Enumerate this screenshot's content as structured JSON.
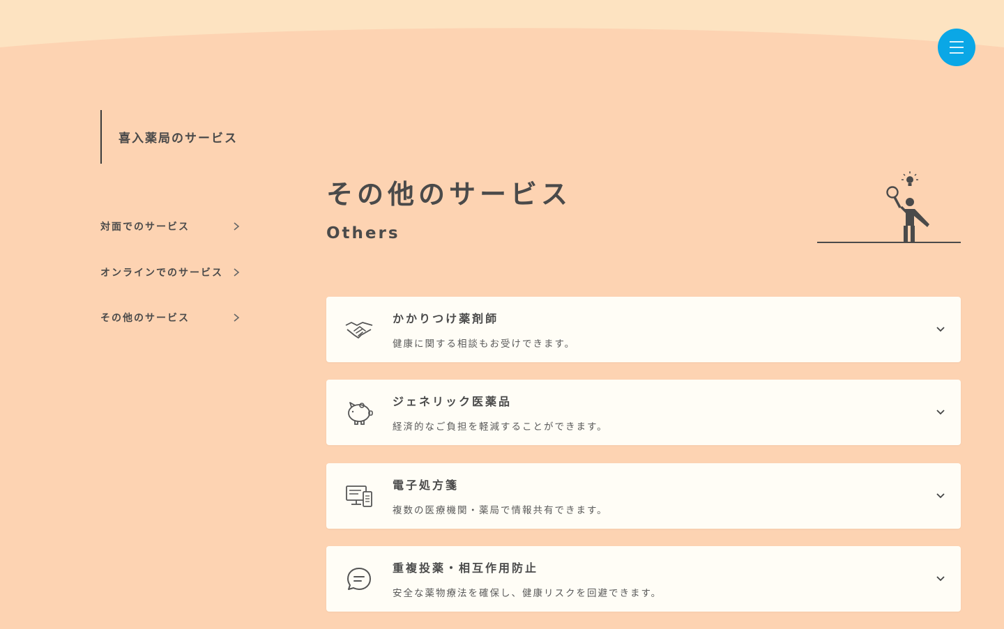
{
  "header": {
    "menu_icon": "hamburger-icon",
    "menu_color": "#0aa7e6"
  },
  "sidebar": {
    "title": "喜入薬局のサービス",
    "items": [
      {
        "label": "対面でのサービス",
        "icon": "chevron-right-icon"
      },
      {
        "label": "オンラインでのサービス",
        "icon": "chevron-right-icon"
      },
      {
        "label": "その他のサービス",
        "icon": "chevron-right-icon"
      }
    ]
  },
  "main": {
    "heading_jp": "その他のサービス",
    "heading_en": "Others",
    "illustration": "person-idea-illustration",
    "services": [
      {
        "title": "かかりつけ薬剤師",
        "description": "健康に関する相談もお受けできます。",
        "icon": "handshake-icon"
      },
      {
        "title": "ジェネリック医薬品",
        "description": "経済的なご負担を軽減することができます。",
        "icon": "piggy-bank-icon"
      },
      {
        "title": "電子処方箋",
        "description": "複数の医療機関・薬局で情報共有できます。",
        "icon": "devices-icon"
      },
      {
        "title": "重複投薬・相互作用防止",
        "description": "安全な薬物療法を確保し、健康リスクを回避できます。",
        "icon": "chat-bubble-icon"
      }
    ]
  },
  "colors": {
    "background": "#fdd3b2",
    "top_band": "#fde3c1",
    "card": "#fffdf6",
    "text": "#4a4a4a",
    "accent": "#0aa7e6"
  }
}
